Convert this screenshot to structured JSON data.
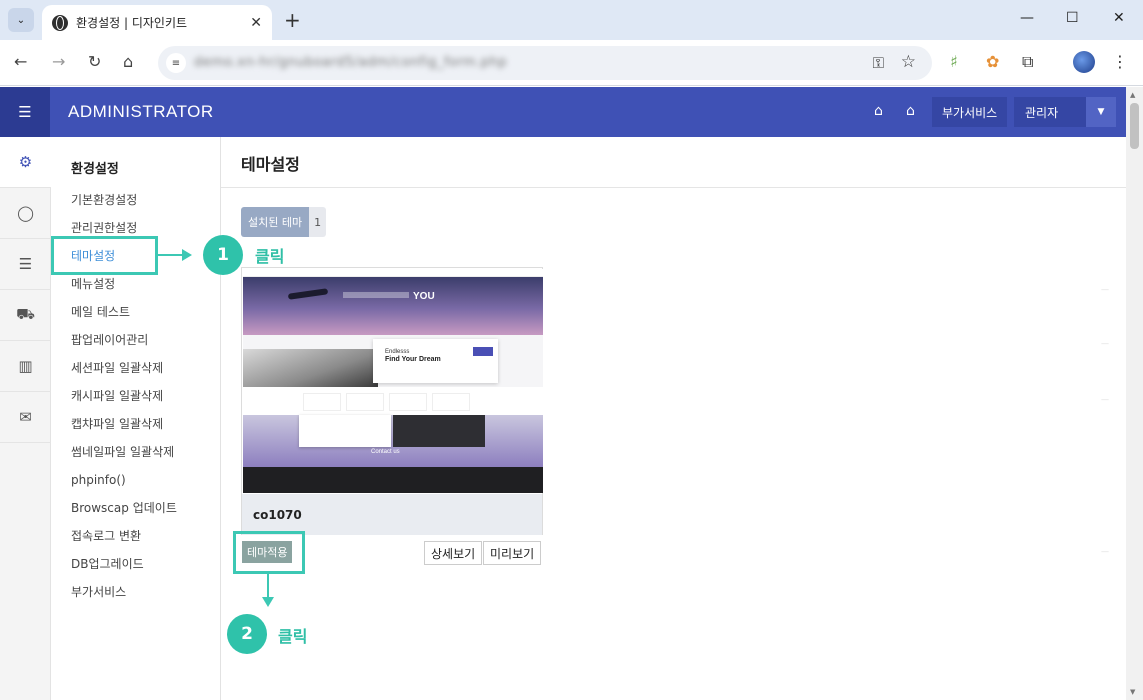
{
  "browser": {
    "tab_title": "환경설정 | 디자인키트",
    "tab_close": "✕",
    "new_tab": "+",
    "url": "demo.xn-hr/gnuboard5/adm/config_form.php",
    "window_controls": [
      "—",
      "☐",
      "✕"
    ],
    "icons": [
      "back-icon",
      "forward-icon",
      "reload-icon",
      "home-icon",
      "key-icon",
      "star-icon",
      "extensions-icon",
      "menu-icon"
    ]
  },
  "admin": {
    "brand": "ADMINISTRATOR",
    "buttons": {
      "add_service": "부가서비스",
      "admin": "관리자"
    },
    "colors": {
      "header": "#3f51b5",
      "header_dark": "#2c3b92",
      "accent": "#3cc8b4"
    }
  },
  "sidebar": {
    "title": "환경설정",
    "items": [
      {
        "label": "기본환경설정"
      },
      {
        "label": "관리권한설정"
      },
      {
        "label": "테마설정",
        "current": true
      },
      {
        "label": "메뉴설정"
      },
      {
        "label": "메일 테스트"
      },
      {
        "label": "팝업레이어관리"
      },
      {
        "label": "세션파일 일괄삭제"
      },
      {
        "label": "캐시파일 일괄삭제"
      },
      {
        "label": "캡챠파일 일괄삭제"
      },
      {
        "label": "썸네일파일 일괄삭제"
      },
      {
        "label": "phpinfo()"
      },
      {
        "label": "Browscap 업데이트"
      },
      {
        "label": "접속로그 변환"
      },
      {
        "label": "DB업그레이드"
      },
      {
        "label": "부가서비스"
      }
    ]
  },
  "main": {
    "title": "테마설정",
    "installed_label": "설치된 테마",
    "installed_count": "1",
    "theme": {
      "name": "co1070",
      "preview_text": {
        "hero": "YOU",
        "card_small": "Endlesss",
        "card_big": "Find Your Dream",
        "contact": "Contact us"
      }
    },
    "buttons": {
      "apply": "테마적용",
      "detail": "상세보기",
      "preview": "미리보기"
    }
  },
  "annotations": [
    {
      "number": "1",
      "label": "클릭"
    },
    {
      "number": "2",
      "label": "클릭"
    }
  ]
}
